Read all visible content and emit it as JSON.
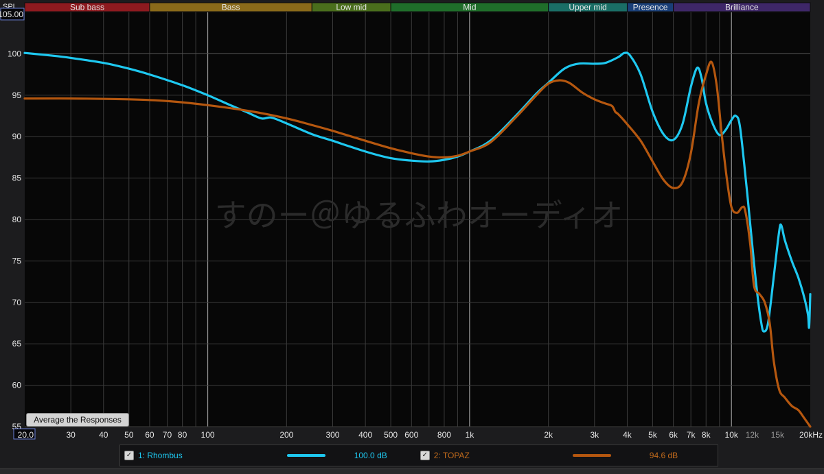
{
  "chart_data": {
    "type": "line",
    "ylabel": "SPL",
    "x_scale": "log",
    "xlim": [
      20,
      20000
    ],
    "ylim": [
      55,
      105
    ],
    "y_ticks": [
      {
        "value": 55,
        "label": "55"
      },
      {
        "value": 60,
        "label": "60"
      },
      {
        "value": 65,
        "label": "65"
      },
      {
        "value": 70,
        "label": "70"
      },
      {
        "value": 75,
        "label": "75"
      },
      {
        "value": 80,
        "label": "80"
      },
      {
        "value": 85,
        "label": "85"
      },
      {
        "value": 90,
        "label": "90"
      },
      {
        "value": 95,
        "label": "95"
      },
      {
        "value": 100,
        "label": "100"
      }
    ],
    "y_top_label": "105.00",
    "x_ticks": [
      {
        "value": 20,
        "label": "20.0"
      },
      {
        "value": 30,
        "label": "30"
      },
      {
        "value": 40,
        "label": "40"
      },
      {
        "value": 50,
        "label": "50"
      },
      {
        "value": 60,
        "label": "60"
      },
      {
        "value": 70,
        "label": "70"
      },
      {
        "value": 80,
        "label": "80"
      },
      {
        "value": 100,
        "label": "100"
      },
      {
        "value": 200,
        "label": "200"
      },
      {
        "value": 300,
        "label": "300"
      },
      {
        "value": 400,
        "label": "400"
      },
      {
        "value": 500,
        "label": "500"
      },
      {
        "value": 600,
        "label": "600"
      },
      {
        "value": 800,
        "label": "800"
      },
      {
        "value": 1000,
        "label": "1k"
      },
      {
        "value": 2000,
        "label": "2k"
      },
      {
        "value": 3000,
        "label": "3k"
      },
      {
        "value": 4000,
        "label": "4k"
      },
      {
        "value": 5000,
        "label": "5k"
      },
      {
        "value": 6000,
        "label": "6k"
      },
      {
        "value": 7000,
        "label": "7k"
      },
      {
        "value": 8000,
        "label": "8k"
      },
      {
        "value": 10000,
        "label": "10k"
      },
      {
        "value": 12000,
        "label": "12k"
      },
      {
        "value": 15000,
        "label": "15k"
      },
      {
        "value": 20000,
        "label": "20kHz"
      }
    ],
    "bands": [
      {
        "name": "Sub bass",
        "from": 20,
        "to": 60,
        "color": "#8e1a1f"
      },
      {
        "name": "Bass",
        "from": 60,
        "to": 250,
        "color": "#8a6a1a"
      },
      {
        "name": "Low mid",
        "from": 250,
        "to": 500,
        "color": "#4a6e1c"
      },
      {
        "name": "Mid",
        "from": 500,
        "to": 2000,
        "color": "#1f6e2a"
      },
      {
        "name": "Upper mid",
        "from": 2000,
        "to": 4000,
        "color": "#1a6e66"
      },
      {
        "name": "Presence",
        "from": 4000,
        "to": 6000,
        "color": "#1a3f78"
      },
      {
        "name": "Brilliance",
        "from": 6000,
        "to": 20000,
        "color": "#3e2768"
      }
    ],
    "watermark": "すのー＠ゆるふわオーディオ",
    "grid": true,
    "series": [
      {
        "name": "Rhombus",
        "color": "#1ec8f0",
        "points": [
          [
            20,
            100.1
          ],
          [
            25,
            99.8
          ],
          [
            30,
            99.5
          ],
          [
            40,
            98.9
          ],
          [
            50,
            98.2
          ],
          [
            60,
            97.5
          ],
          [
            80,
            96.2
          ],
          [
            100,
            95.0
          ],
          [
            120,
            93.9
          ],
          [
            140,
            93.0
          ],
          [
            160,
            92.2
          ],
          [
            175,
            92.3
          ],
          [
            200,
            91.6
          ],
          [
            250,
            90.3
          ],
          [
            300,
            89.5
          ],
          [
            400,
            88.2
          ],
          [
            500,
            87.4
          ],
          [
            600,
            87.1
          ],
          [
            700,
            87.0
          ],
          [
            800,
            87.2
          ],
          [
            900,
            87.6
          ],
          [
            1000,
            88.2
          ],
          [
            1200,
            89.5
          ],
          [
            1500,
            92.5
          ],
          [
            1800,
            95.2
          ],
          [
            2000,
            96.5
          ],
          [
            2300,
            98.2
          ],
          [
            2600,
            98.8
          ],
          [
            3000,
            98.8
          ],
          [
            3300,
            98.9
          ],
          [
            3700,
            99.6
          ],
          [
            3900,
            100.1
          ],
          [
            4100,
            99.8
          ],
          [
            4500,
            97.5
          ],
          [
            5000,
            93.0
          ],
          [
            5500,
            90.3
          ],
          [
            6000,
            89.6
          ],
          [
            6500,
            91.5
          ],
          [
            7000,
            96.0
          ],
          [
            7400,
            98.3
          ],
          [
            7700,
            97.0
          ],
          [
            8000,
            94.0
          ],
          [
            8500,
            91.5
          ],
          [
            9000,
            90.2
          ],
          [
            9500,
            90.8
          ],
          [
            10000,
            92.0
          ],
          [
            10400,
            92.5
          ],
          [
            10800,
            91.0
          ],
          [
            11500,
            83.0
          ],
          [
            12000,
            77.0
          ],
          [
            12500,
            71.5
          ],
          [
            13000,
            67.5
          ],
          [
            13300,
            66.5
          ],
          [
            13800,
            67.5
          ],
          [
            14500,
            73.0
          ],
          [
            15200,
            78.5
          ],
          [
            15500,
            79.3
          ],
          [
            16000,
            77.5
          ],
          [
            17000,
            75.0
          ],
          [
            18000,
            73.0
          ],
          [
            19000,
            70.5
          ],
          [
            19600,
            68.5
          ],
          [
            19800,
            67.0
          ],
          [
            20000,
            71.0
          ]
        ]
      },
      {
        "name": "TOPAZ",
        "color": "#b5570f",
        "points": [
          [
            20,
            94.6
          ],
          [
            30,
            94.6
          ],
          [
            50,
            94.5
          ],
          [
            70,
            94.3
          ],
          [
            100,
            93.8
          ],
          [
            150,
            93.0
          ],
          [
            200,
            92.2
          ],
          [
            250,
            91.4
          ],
          [
            300,
            90.7
          ],
          [
            400,
            89.5
          ],
          [
            500,
            88.6
          ],
          [
            600,
            88.0
          ],
          [
            700,
            87.6
          ],
          [
            800,
            87.5
          ],
          [
            900,
            87.7
          ],
          [
            1000,
            88.2
          ],
          [
            1200,
            89.3
          ],
          [
            1500,
            92.3
          ],
          [
            1800,
            95.0
          ],
          [
            2000,
            96.4
          ],
          [
            2200,
            96.8
          ],
          [
            2400,
            96.5
          ],
          [
            2700,
            95.3
          ],
          [
            3000,
            94.5
          ],
          [
            3300,
            94.0
          ],
          [
            3500,
            93.7
          ],
          [
            3600,
            93.0
          ],
          [
            3700,
            92.7
          ],
          [
            4000,
            91.5
          ],
          [
            4500,
            89.5
          ],
          [
            5000,
            87.0
          ],
          [
            5500,
            84.8
          ],
          [
            6000,
            83.8
          ],
          [
            6500,
            84.5
          ],
          [
            7000,
            88.0
          ],
          [
            7500,
            94.0
          ],
          [
            8000,
            97.5
          ],
          [
            8400,
            99.0
          ],
          [
            8800,
            96.0
          ],
          [
            9200,
            90.0
          ],
          [
            9600,
            85.0
          ],
          [
            10000,
            81.5
          ],
          [
            10500,
            80.8
          ],
          [
            11000,
            81.5
          ],
          [
            11300,
            81.0
          ],
          [
            11800,
            77.0
          ],
          [
            12200,
            72.0
          ],
          [
            12800,
            71.0
          ],
          [
            13400,
            70.0
          ],
          [
            14000,
            67.5
          ],
          [
            14500,
            63.0
          ],
          [
            15200,
            59.5
          ],
          [
            16000,
            58.5
          ],
          [
            17000,
            57.5
          ],
          [
            18000,
            57.0
          ],
          [
            19000,
            56.0
          ],
          [
            20000,
            55.0
          ]
        ]
      }
    ]
  },
  "legend": {
    "items": [
      {
        "label": "1: Rhombus",
        "color": "#1ec8f0",
        "value": "100.0 dB",
        "checked": true
      },
      {
        "label": "2: TOPAZ",
        "color": "#c06a1c",
        "value": "94.6 dB",
        "checked": true
      }
    ]
  },
  "buttons": {
    "average_label": "Average the Responses"
  }
}
